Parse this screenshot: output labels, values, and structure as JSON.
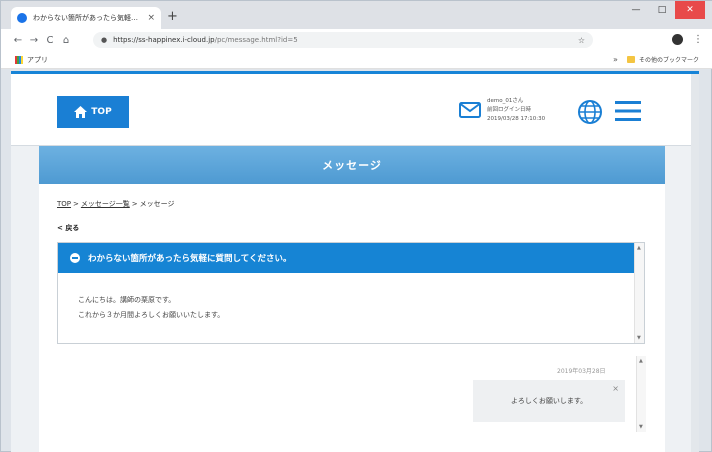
{
  "browser": {
    "tab_title": "わからない箇所があったら気軽に質問",
    "tab_close": "×",
    "new_tab": "+",
    "nav": {
      "back": "←",
      "forward": "→",
      "reload": "C",
      "home": "⌂"
    },
    "url_host": "https://ss-happinex.i-cloud.jp",
    "url_path": "/pc/message.html?id=5",
    "star": "☆",
    "menu": "⋮",
    "win_min": "—",
    "win_max": "□",
    "win_close": "✕",
    "apps_label": "アプリ",
    "bookmark_chevron": "»",
    "other_bookmarks": "その他のブックマーク"
  },
  "header": {
    "top_label": "TOP",
    "username": "demo_01さん",
    "last_login_label": "前回ログイン日時",
    "last_login_time": "2019/03/28 17:10:30"
  },
  "page": {
    "banner_title": "メッセージ",
    "breadcrumb": [
      "TOP",
      "メッセージ一覧",
      "メッセージ"
    ],
    "breadcrumb_sep": ">",
    "back_label": "戻る",
    "back_arrow": "<",
    "message": {
      "title": "わからない箇所があったら気軽に質問してください。",
      "body_line1": "こんにちは。講師の栗原です。",
      "body_line2": "これから３か月間よろしくお願いいたします。"
    },
    "reply": {
      "date": "2019年03月28日",
      "text": "よろしくお願いします。",
      "close": "×"
    }
  },
  "colors": {
    "accent": "#1a7fd4",
    "banner": "#5ba5da"
  }
}
